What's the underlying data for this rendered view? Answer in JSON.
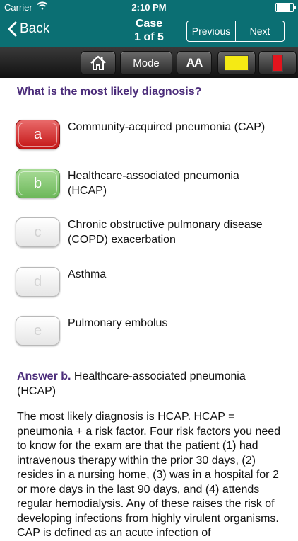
{
  "status_bar": {
    "carrier": "Carrier",
    "time": "2:10 PM",
    "battery_level": 0.95
  },
  "nav": {
    "back_label": "Back",
    "title_line1": "Case",
    "title_line2": "1 of 5",
    "previous_label": "Previous",
    "next_label": "Next"
  },
  "toolbar": {
    "home_icon": "home-icon",
    "mode_label": "Mode",
    "font_size_label": "AA",
    "highlight_yellow_color": "#f5ea14",
    "highlight_red_color": "#e3141d"
  },
  "question": "What is the most likely diagnosis?",
  "options": [
    {
      "letter": "a",
      "text": "Community-acquired pneumonia (CAP)",
      "state": "incorrect"
    },
    {
      "letter": "b",
      "text": "Healthcare-associated pneumonia (HCAP)",
      "state": "correct"
    },
    {
      "letter": "c",
      "text": "Chronic obstructive pulmonary disease (COPD) exacerbation",
      "state": "neutral"
    },
    {
      "letter": "d",
      "text": "Asthma",
      "state": "neutral"
    },
    {
      "letter": "e",
      "text": "Pulmonary embolus",
      "state": "neutral"
    }
  ],
  "answer": {
    "lead": "Answer b.",
    "text": "Healthcare-associated pneumonia (HCAP)"
  },
  "explanation": "The most likely diagnosis is HCAP. HCAP = pneumonia + a risk factor. Four risk factors you need to know for the exam are that the patient (1) had intravenous therapy within the prior 30 days, (2) resides in a nursing home, (3) was in a hospital for 2 or more days in the last 90 days, and (4) attends regular hemodialysis. Any of these raises the risk of developing infections from highly virulent organisms. CAP is defined as an acute infection of",
  "colors": {
    "nav_teal": "#0b6f73",
    "question_purple": "#4b2c7a",
    "incorrect_red": "#c41515",
    "correct_green": "#6db85a"
  }
}
